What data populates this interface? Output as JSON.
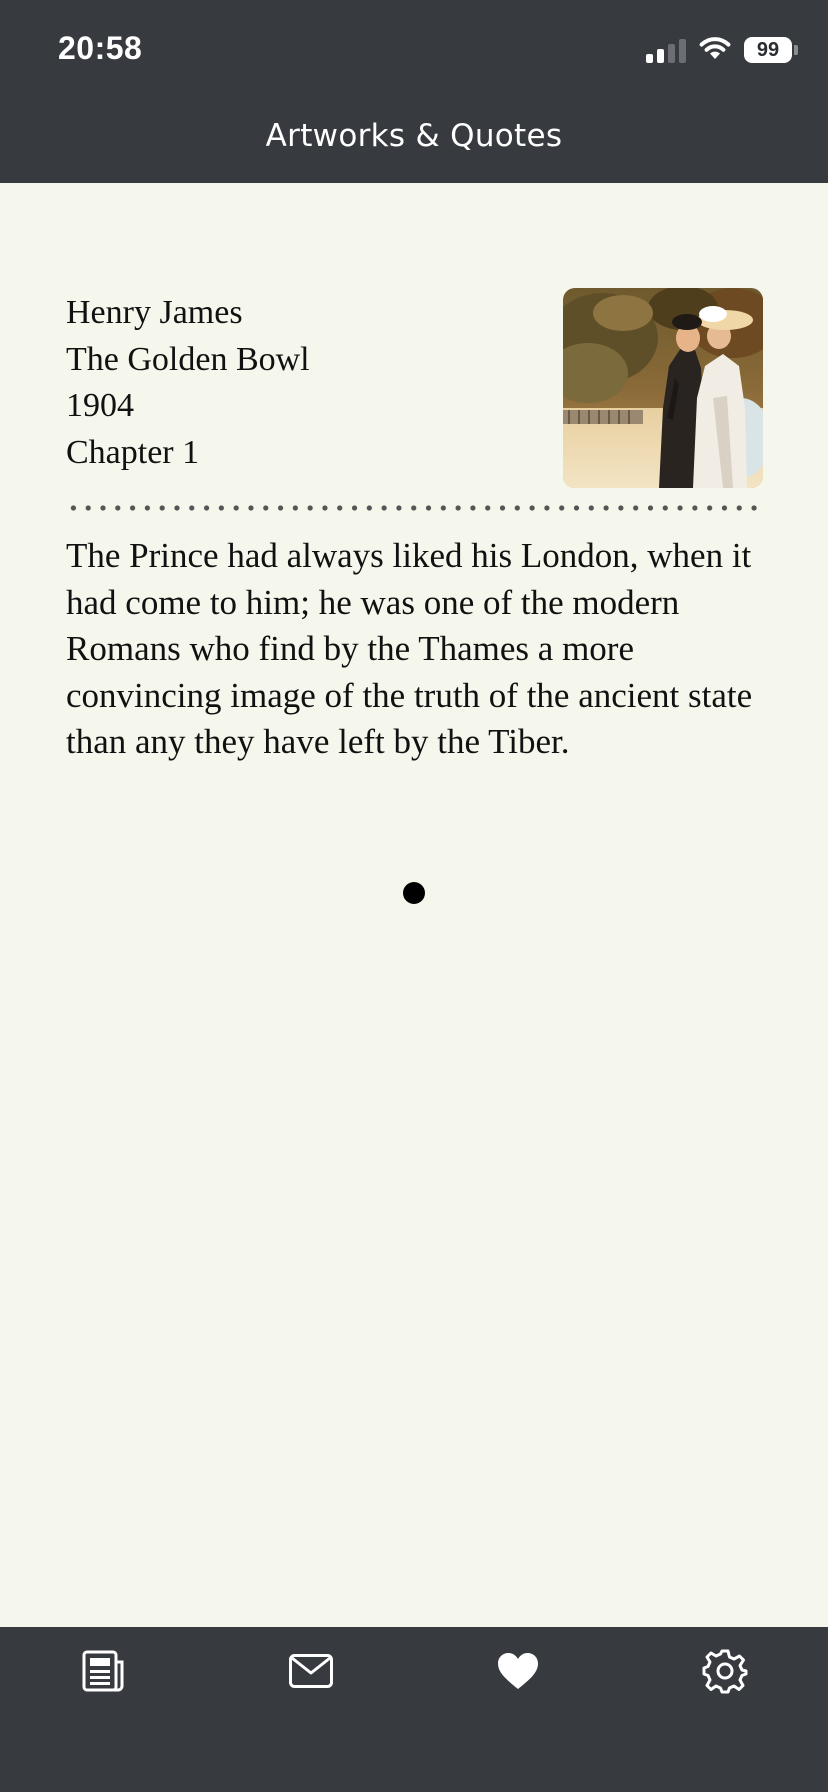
{
  "status_bar": {
    "time": "20:58",
    "battery": "99"
  },
  "header": {
    "title": "Artworks & Quotes"
  },
  "entry": {
    "author": "Henry James",
    "work": "The Golden Bowl",
    "year": "1904",
    "chapter": "Chapter 1",
    "quote": "The Prince had always liked his London, when it had come to him; he was one of the modern Romans who find by the Thames a more convincing image of the truth of the ancient state than any they have left by the Tiber.",
    "artwork_alt": "impressionist painting of figures in a park"
  },
  "pager": {
    "current": 1,
    "total": 1
  },
  "tabbar": {
    "items": [
      {
        "name": "news",
        "icon": "newspaper-icon"
      },
      {
        "name": "mail",
        "icon": "envelope-icon"
      },
      {
        "name": "favorites",
        "icon": "heart-icon",
        "active": true
      },
      {
        "name": "settings",
        "icon": "gear-icon"
      }
    ]
  },
  "colors": {
    "bar_background": "#373b3f",
    "page_background": "#f5f6ec",
    "text": "#111111",
    "icon": "#ffffff"
  }
}
